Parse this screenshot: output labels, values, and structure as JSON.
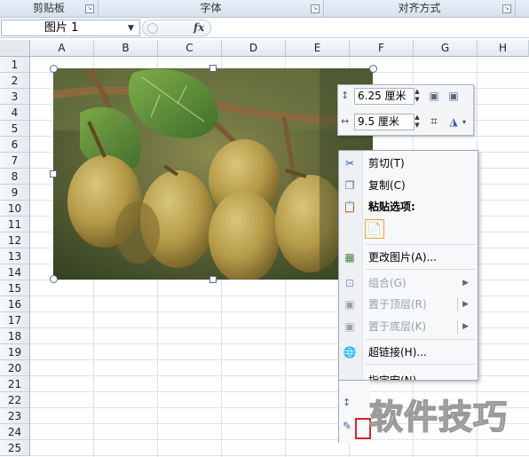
{
  "ribbon": {
    "groups": [
      "剪贴板",
      "字体",
      "对齐方式"
    ]
  },
  "formula_bar": {
    "name_box": "图片 1",
    "fx_label": "fx"
  },
  "columns": [
    "A",
    "B",
    "C",
    "D",
    "E",
    "F",
    "G",
    "H"
  ],
  "rows": [
    "1",
    "2",
    "3",
    "4",
    "5",
    "6",
    "7",
    "8",
    "9",
    "10",
    "11",
    "12",
    "13",
    "14",
    "15",
    "16",
    "17",
    "18",
    "19",
    "20",
    "21",
    "22",
    "23",
    "24",
    "25"
  ],
  "size_toolbar": {
    "height_value": "6.25 厘米",
    "width_value": "9.5 厘米"
  },
  "context_menu": {
    "items": [
      {
        "label": "剪切(T)",
        "icon": "scissors-icon",
        "enabled": true
      },
      {
        "label": "复制(C)",
        "icon": "copy-icon",
        "enabled": true
      },
      {
        "label": "粘贴选项:",
        "icon": "paste-icon",
        "enabled": true,
        "bold": true
      },
      {
        "label": "更改图片(A)...",
        "icon": "change-picture-icon",
        "enabled": true
      },
      {
        "label": "组合(G)",
        "icon": "group-icon",
        "enabled": false,
        "submenu": true
      },
      {
        "label": "置于顶层(R)",
        "icon": "bring-to-front-icon",
        "enabled": false,
        "submenu": true
      },
      {
        "label": "置于底层(K)",
        "icon": "send-to-back-icon",
        "enabled": false,
        "submenu": true
      },
      {
        "label": "超链接(H)...",
        "icon": "hyperlink-icon",
        "enabled": true
      },
      {
        "label": "指定宏(N)...",
        "icon": "",
        "enabled": true
      }
    ]
  },
  "watermark": "软件技巧",
  "colors": {
    "selection_handle_border": "#5a6e8a",
    "highlight_box": "#d9262c",
    "disabled_text": "#9aa0a8"
  }
}
